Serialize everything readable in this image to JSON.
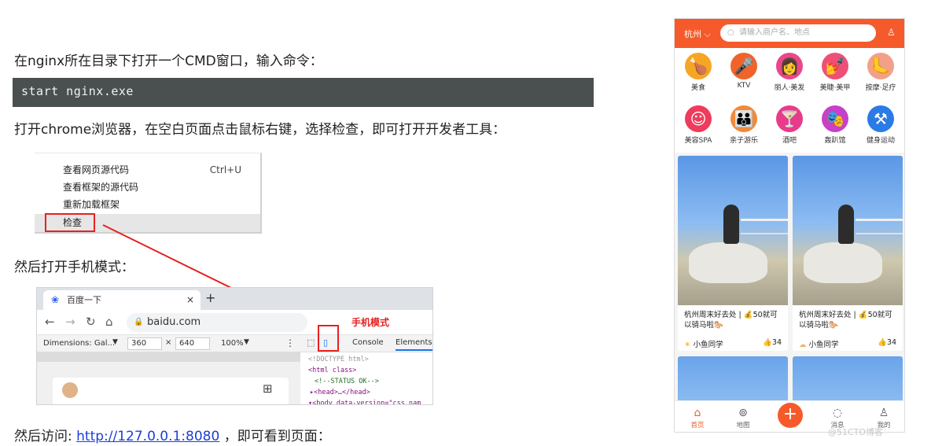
{
  "doc": {
    "p1": "在nginx所在目录下打开一个CMD窗口，输入命令：",
    "code": "start nginx.exe",
    "p2": "打开chrome浏览器，在空白页面点击鼠标右键，选择检查，即可打开开发者工具：",
    "p3": "然后打开手机模式：",
    "p4_prefix": "然后访问: ",
    "p4_link": "http://127.0.0.1:8080",
    "p4_suffix": " ，即可看到页面："
  },
  "context_menu": {
    "items": [
      {
        "label": "查看网页源代码",
        "shortcut": "Ctrl+U"
      },
      {
        "label": "查看框架的源代码",
        "shortcut": ""
      },
      {
        "label": "重新加载框架",
        "shortcut": ""
      },
      {
        "label": "检查",
        "shortcut": ""
      }
    ]
  },
  "browser": {
    "tab_title": "百度一下",
    "tab_close": "×",
    "new_tab": "+",
    "url": "baidu.com",
    "mobile_mode_label": "手机模式",
    "dimensions": "Dimensions: Gal...",
    "width": "360",
    "times": "×",
    "height": "640",
    "zoom": "100%",
    "devtools_tabs": [
      "Console",
      "Elements"
    ],
    "code_lines": [
      "<!DOCTYPE html>",
      "<html class>",
      "<!--STATUS OK-->",
      "▸<head>…</head>",
      "▾<body data-version=\"css_nam"
    ]
  },
  "phone": {
    "city": "杭州 ⌵",
    "search_placeholder": "请输入商户名、地点",
    "categories": [
      {
        "label": "美食",
        "icon": "food-icon",
        "color": "#f5a623"
      },
      {
        "label": "KTV",
        "icon": "microphone-icon",
        "color": "#f0642b"
      },
      {
        "label": "丽人·美发",
        "icon": "hair-icon",
        "color": "#e8488a"
      },
      {
        "label": "美睫·美甲",
        "icon": "nail-icon",
        "color": "#ef4f77"
      },
      {
        "label": "按摩·足疗",
        "icon": "foot-icon",
        "color": "#f2a08a"
      },
      {
        "label": "美容SPA",
        "icon": "spa-icon",
        "color": "#ef3b5c"
      },
      {
        "label": "亲子游乐",
        "icon": "parent-child-icon",
        "color": "#f18a3a"
      },
      {
        "label": "酒吧",
        "icon": "cocktail-icon",
        "color": "#e83b8c"
      },
      {
        "label": "轰趴馆",
        "icon": "mask-icon",
        "color": "#c640c9"
      },
      {
        "label": "健身运动",
        "icon": "dumbbell-icon",
        "color": "#2b7be6"
      }
    ],
    "cards": [
      {
        "title": "杭州周末好去处 | 💰50就可以骑马啦🐎",
        "user": "小鱼同学",
        "likes": "34"
      },
      {
        "title": "杭州周末好去处 | 💰50就可以骑马啦🐎",
        "user": "小鱼同学",
        "likes": "34"
      }
    ],
    "nav": [
      {
        "label": "首页",
        "icon": "home-icon"
      },
      {
        "label": "地图",
        "icon": "map-pin-icon"
      },
      {
        "label": "",
        "icon": "plus-icon"
      },
      {
        "label": "消息",
        "icon": "message-icon"
      },
      {
        "label": "我的",
        "icon": "user-icon"
      }
    ]
  },
  "watermark": "@51CTO博客",
  "colors": {
    "accent": "#f65a2a",
    "highlight_red": "#e52222",
    "link": "#1a3fd8"
  }
}
